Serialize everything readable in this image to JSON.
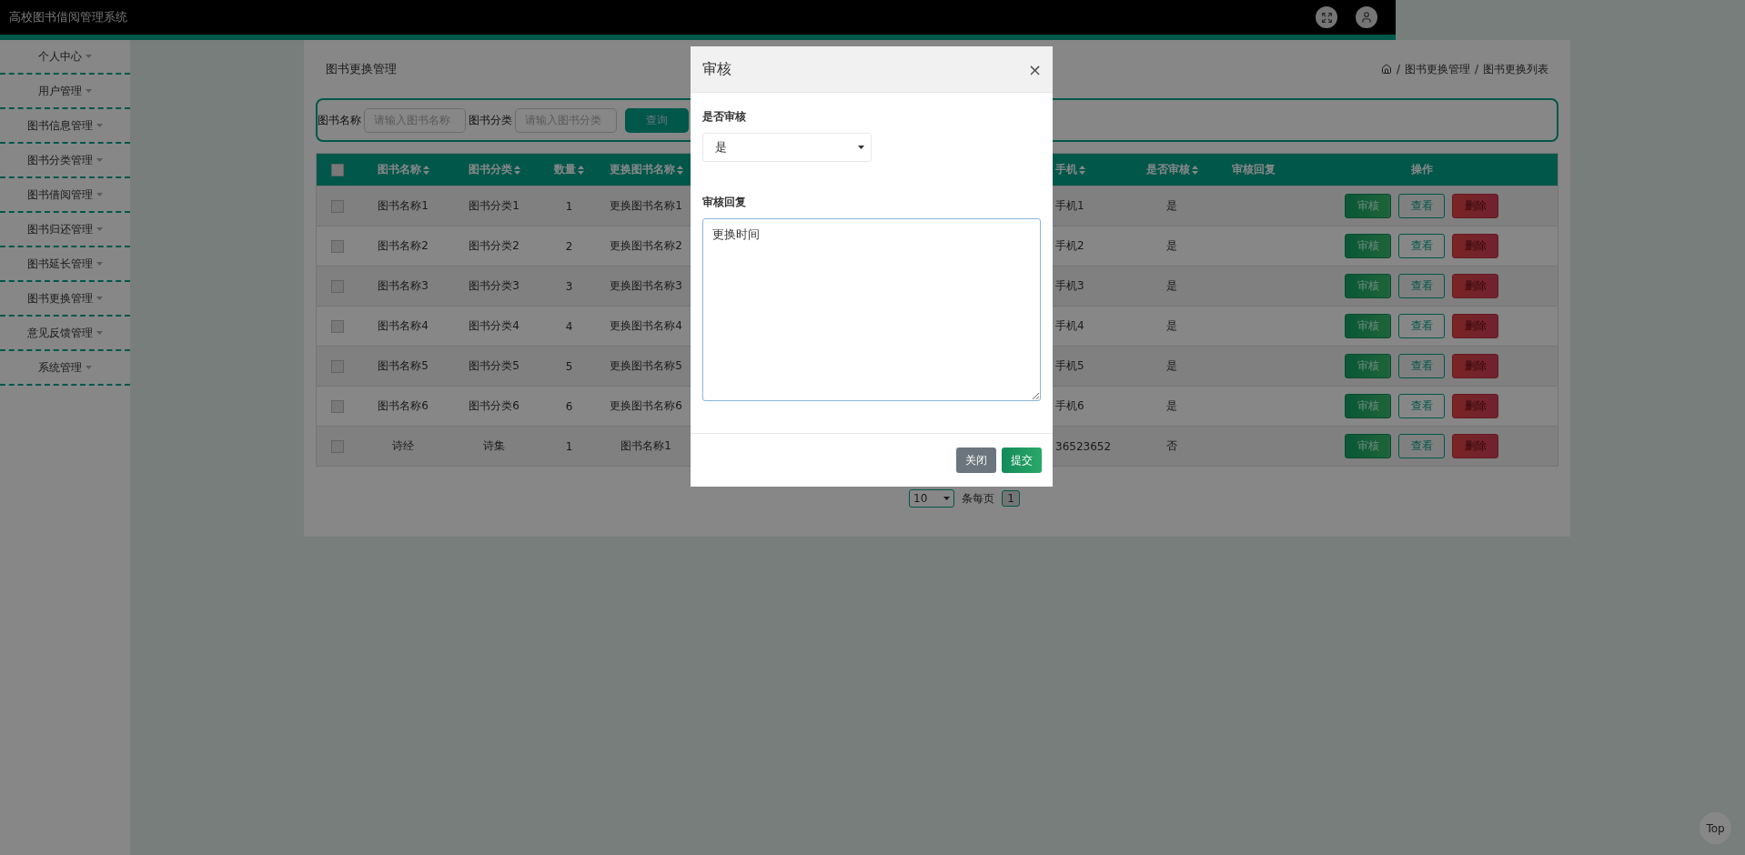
{
  "header": {
    "title": "高校图书借阅管理系统"
  },
  "sidebar": {
    "items": [
      {
        "label": "个人中心"
      },
      {
        "label": "用户管理"
      },
      {
        "label": "图书信息管理"
      },
      {
        "label": "图书分类管理"
      },
      {
        "label": "图书借阅管理"
      },
      {
        "label": "图书归还管理"
      },
      {
        "label": "图书延长管理"
      },
      {
        "label": "图书更换管理"
      },
      {
        "label": "意见反馈管理"
      },
      {
        "label": "系统管理"
      }
    ]
  },
  "page": {
    "title": "图书更换管理",
    "breadcrumb_separator": "/",
    "breadcrumb": [
      "图书更换管理",
      "图书更换列表"
    ]
  },
  "search": {
    "fields": [
      {
        "label": "图书名称",
        "placeholder": "请输入图书名称"
      },
      {
        "label": "图书分类",
        "placeholder": "请输入图书分类"
      }
    ],
    "button": "查询"
  },
  "table": {
    "header_checked": false,
    "columns": [
      {
        "label": "图书名称",
        "sortable": true
      },
      {
        "label": "图书分类",
        "sortable": true
      },
      {
        "label": "数量",
        "sortable": true
      },
      {
        "label": "更换图书名称",
        "sortable": true
      },
      {
        "label": "手机",
        "sortable": true
      },
      {
        "label": "是否审核",
        "sortable": true
      },
      {
        "label": "审核回复",
        "sortable": false
      },
      {
        "label": "操作",
        "sortable": false
      }
    ],
    "rows": [
      {
        "checked": false,
        "cells": [
          "图书名称1",
          "图书分类1",
          "1",
          "更换图书名称1",
          "手机1",
          "是"
        ],
        "actions": [
          "审核",
          "查看",
          "删除"
        ]
      },
      {
        "checked": false,
        "cells": [
          "图书名称2",
          "图书分类2",
          "2",
          "更换图书名称2",
          "手机2",
          "是"
        ],
        "actions": [
          "审核",
          "查看",
          "删除"
        ]
      },
      {
        "checked": false,
        "cells": [
          "图书名称3",
          "图书分类3",
          "3",
          "更换图书名称3",
          "手机3",
          "是"
        ],
        "actions": [
          "审核",
          "查看",
          "删除"
        ]
      },
      {
        "checked": false,
        "cells": [
          "图书名称4",
          "图书分类4",
          "4",
          "更换图书名称4",
          "手机4",
          "是"
        ],
        "actions": [
          "审核",
          "查看",
          "删除"
        ]
      },
      {
        "checked": false,
        "cells": [
          "图书名称5",
          "图书分类5",
          "5",
          "更换图书名称5",
          "手机5",
          "是"
        ],
        "actions": [
          "审核",
          "查看",
          "删除"
        ]
      },
      {
        "checked": false,
        "cells": [
          "图书名称6",
          "图书分类6",
          "6",
          "更换图书名称6",
          "手机6",
          "是"
        ],
        "actions": [
          "审核",
          "查看",
          "删除"
        ]
      },
      {
        "checked": false,
        "cells": [
          "诗经",
          "诗集",
          "1",
          "图书名称1",
          "36523652",
          "否"
        ],
        "actions": [
          "审核",
          "查看",
          "删除"
        ]
      }
    ]
  },
  "pagination": {
    "page_size": "10",
    "per_page_label": "条每页",
    "pages": [
      {
        "label": "1",
        "selected": true
      }
    ]
  },
  "top_button": "Top",
  "modal": {
    "title": "审核",
    "close": "×",
    "fields": [
      {
        "kind": "select",
        "label": "是否审核",
        "value": "是"
      },
      {
        "kind": "textarea",
        "label": "审核回复",
        "value": "更换时间"
      }
    ],
    "buttons": [
      {
        "label": "关闭",
        "kind": "secondary"
      },
      {
        "label": "提交",
        "kind": "primary"
      }
    ]
  }
}
